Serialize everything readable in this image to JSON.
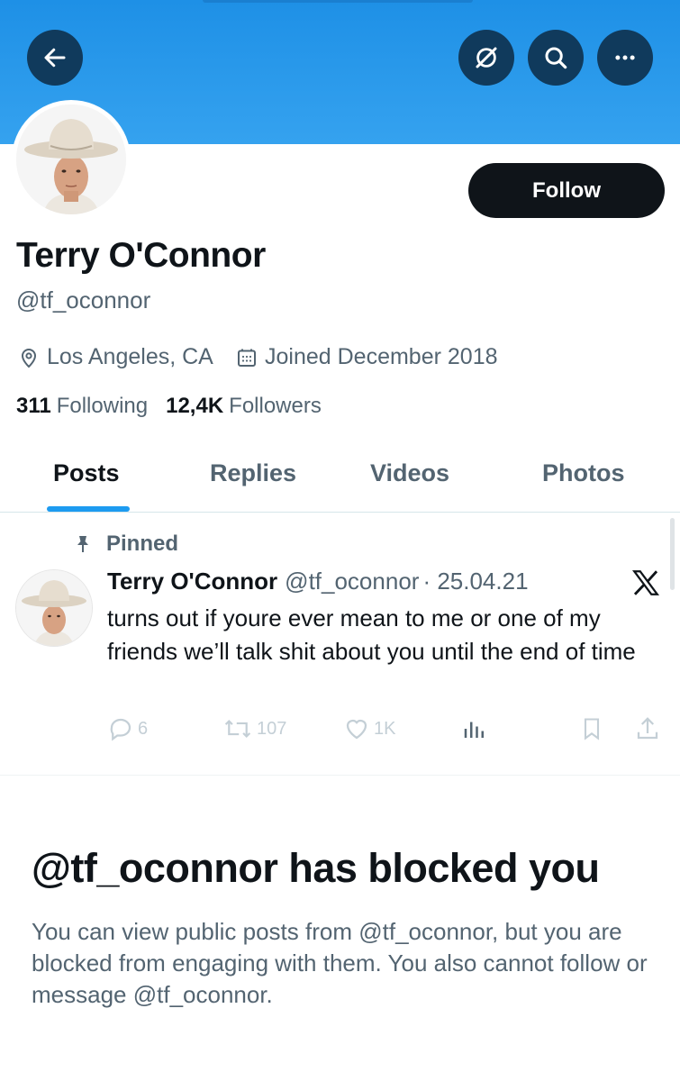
{
  "header": {
    "back_icon": "arrow-left-icon",
    "grok_icon": "grok-icon",
    "search_icon": "search-icon",
    "more_icon": "more-dots-icon",
    "banner_color": "#1d9bf0"
  },
  "profile": {
    "name": "Terry O'Connor",
    "handle": "@tf_oconnor",
    "location": "Los Angeles, CA",
    "joined": "Joined December 2018",
    "following_count": "311",
    "following_label": "Following",
    "followers_count": "12,4K",
    "followers_label": "Followers",
    "follow_button": "Follow"
  },
  "tabs": [
    {
      "label": "Posts",
      "active": true
    },
    {
      "label": "Replies",
      "active": false
    },
    {
      "label": "Videos",
      "active": false
    },
    {
      "label": "Photos",
      "active": false
    }
  ],
  "pinned_post": {
    "pinned_label": "Pinned",
    "author": "Terry O'Connor",
    "handle": "@tf_oconnor",
    "date": "· 25.04.21",
    "text": "turns out if youre ever mean to me or one of my friends we’ll talk shit about you until the end of time",
    "replies": "6",
    "reposts": "107",
    "likes": "1K"
  },
  "blocked": {
    "title": "@tf_oconnor has blocked you",
    "message": "You can view public posts from @tf_oconnor, but you are blocked from engaging with them. You also cannot follow or message @tf_oconnor."
  },
  "colors": {
    "accent": "#1d9bf0",
    "text": "#0f1419",
    "muted": "#536471"
  }
}
